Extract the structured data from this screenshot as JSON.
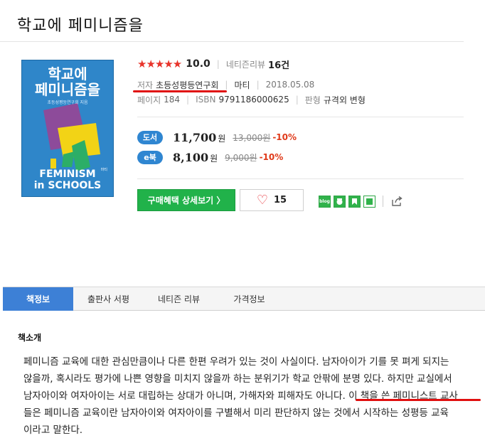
{
  "book": {
    "title": "학교에 페미니즘을",
    "rating_stars": "★★★★★",
    "rating": "10.0",
    "review_label": "네티즌리뷰",
    "review_count": "16건",
    "author_label": "저자",
    "author": "초등성평등연구회",
    "publisher": "마티",
    "date": "2018.05.08",
    "pages_label": "페이지",
    "pages": "184",
    "isbn_label": "ISBN",
    "isbn": "9791186000625",
    "format_label": "판형",
    "format": "규격외 변형"
  },
  "cover": {
    "title_line1": "학교에",
    "title_line2": "페미니즘을",
    "subtitle": "초등성평등연구회 지음",
    "english_line1": "FEMINISM",
    "english_line2": "in SCHOOLS",
    "publisher_mark": "마티"
  },
  "prices": {
    "book": {
      "badge": "도서",
      "price": "11,700",
      "unit": "원",
      "original": "13,000원",
      "discount": "-10%"
    },
    "ebook": {
      "badge": "e북",
      "price": "8,100",
      "unit": "원",
      "original": "9,000원",
      "discount": "-10%"
    }
  },
  "actions": {
    "buy_label": "구매혜택 상세보기 〉",
    "like_count": "15",
    "blog_label": "blog"
  },
  "tabs": [
    {
      "label": "책정보"
    },
    {
      "label": "출판사 서평"
    },
    {
      "label": "네티즌 리뷰"
    },
    {
      "label": "가격정보"
    }
  ],
  "intro": {
    "heading": "책소개",
    "lines": [
      "페미니즘 교육에 대한 관심만큼이나 다른 한편 우려가 있는 것이 사실이다. 남자아이가 기를 못 펴게 되지는",
      "않을까, 혹시라도 평가에 나쁜 영향을 미치지 않을까 하는 분위기가 학교 안팎에 분명 있다. 하지만 교실에서",
      "남자아이와 여자아이는 서로 대립하는 상대가 아니며, 가해자와 피해자도 아니다. 이 책을 쓴 페미니스트 교사",
      "들은 페미니즘 교육이란 남자아이와 여자아이를 구별해서 미리 판단하지 않는 것에서 시작하는 성평등 교육",
      "이라고 말한다."
    ]
  },
  "colors": {
    "accent": "#e01010",
    "tab_active": "#3d80d6",
    "buy_green": "#21b24a",
    "badge_blue": "#2f86d1"
  }
}
